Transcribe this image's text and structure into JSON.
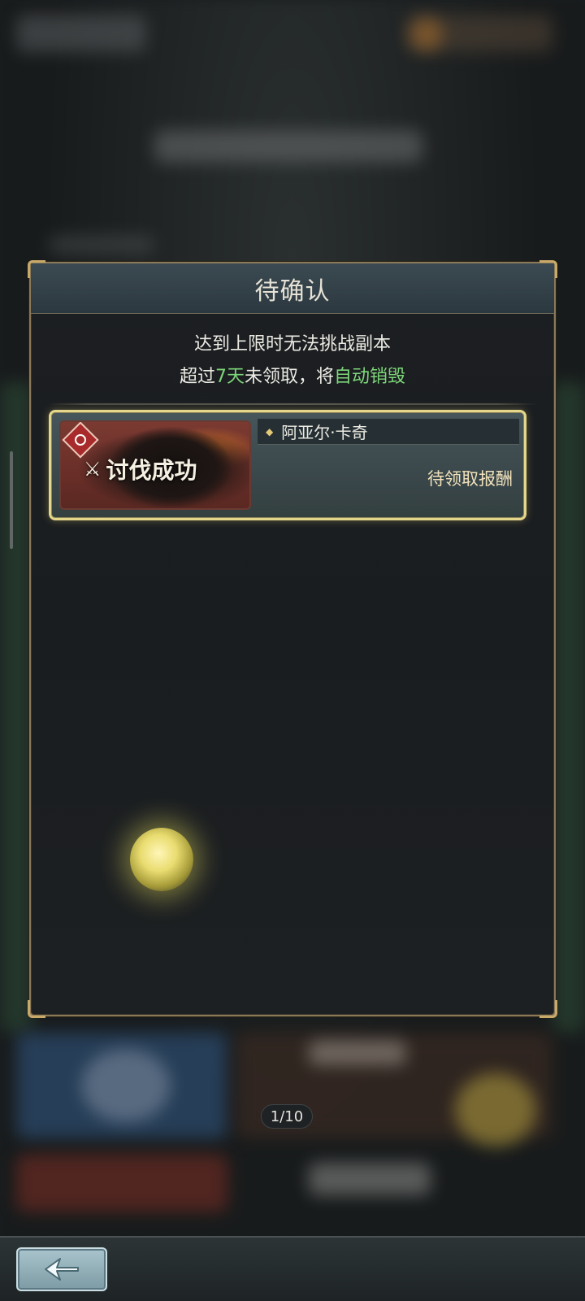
{
  "dialog": {
    "title": "待确认",
    "notice_line1": "达到上限时无法挑战副本",
    "notice_line2_prefix": "超过",
    "notice_line2_days": "7天",
    "notice_line2_middle": "未领取，将",
    "notice_line2_action": "自动销毁"
  },
  "record": {
    "result_label": "讨伐成功",
    "boss_name": "阿亚尔·卡奇",
    "status": "待领取报酬",
    "element_icon": "fire-icon"
  },
  "pager": {
    "text": "1/10"
  },
  "bottom_bar": {
    "back_icon": "back-arrow-icon"
  },
  "colors": {
    "accent_green": "#7ed67a",
    "card_border": "#e4d68a",
    "frame_gold": "#c9a968"
  }
}
